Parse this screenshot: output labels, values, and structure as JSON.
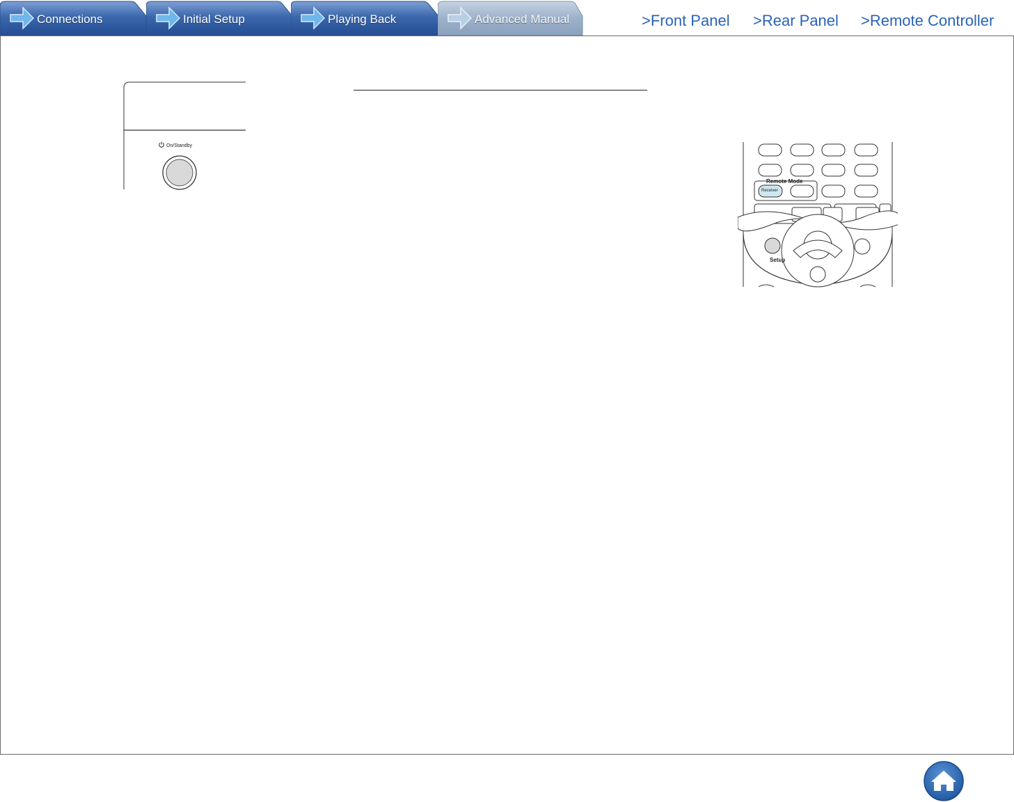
{
  "nav": {
    "tabs": [
      {
        "label": "Connections",
        "active": false
      },
      {
        "label": "Initial Setup",
        "active": false
      },
      {
        "label": "Playing Back",
        "active": false
      },
      {
        "label": "Advanced Manual",
        "active": true
      }
    ],
    "links": [
      {
        "label": ">Front Panel"
      },
      {
        "label": ">Rear Panel"
      },
      {
        "label": ">Remote Controller"
      }
    ]
  },
  "front_panel": {
    "power_label": "On/Standby"
  },
  "remote": {
    "remote_mode_label": "Remote Mode",
    "receiver_label": "Receiver",
    "setup_label": "Setup"
  },
  "footer": {
    "home_icon": "home-icon"
  },
  "colors": {
    "tab_blue": "#3e6bb0",
    "tab_active": "#9fb3cc",
    "link_blue": "#2a63b8",
    "home_blue": "#1f5fae"
  }
}
